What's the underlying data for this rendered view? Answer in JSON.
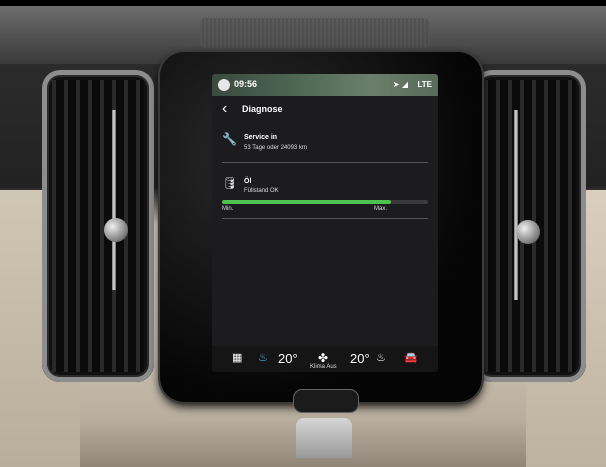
{
  "status": {
    "time": "09:56",
    "network": "LTE"
  },
  "screen": {
    "title": "Diagnose",
    "service": {
      "title": "Service in",
      "detail": "53 Tage oder 24093 km"
    },
    "oil": {
      "title": "Öl",
      "detail": "Füllstand OK",
      "level_fraction": 0.82,
      "min_label": "Min.",
      "max_label": "Max."
    }
  },
  "dock": {
    "temp_left": "20°",
    "temp_right": "20°",
    "climate_label": "Klima Aus"
  },
  "icons": {
    "back": "chevron-left",
    "service": "wrench",
    "oil": "oil-can",
    "apps": "grid",
    "seat_left": "seat",
    "fan": "fan",
    "seat_right": "seat",
    "car": "car"
  },
  "colors": {
    "oil_bar": "#4ec24e"
  }
}
